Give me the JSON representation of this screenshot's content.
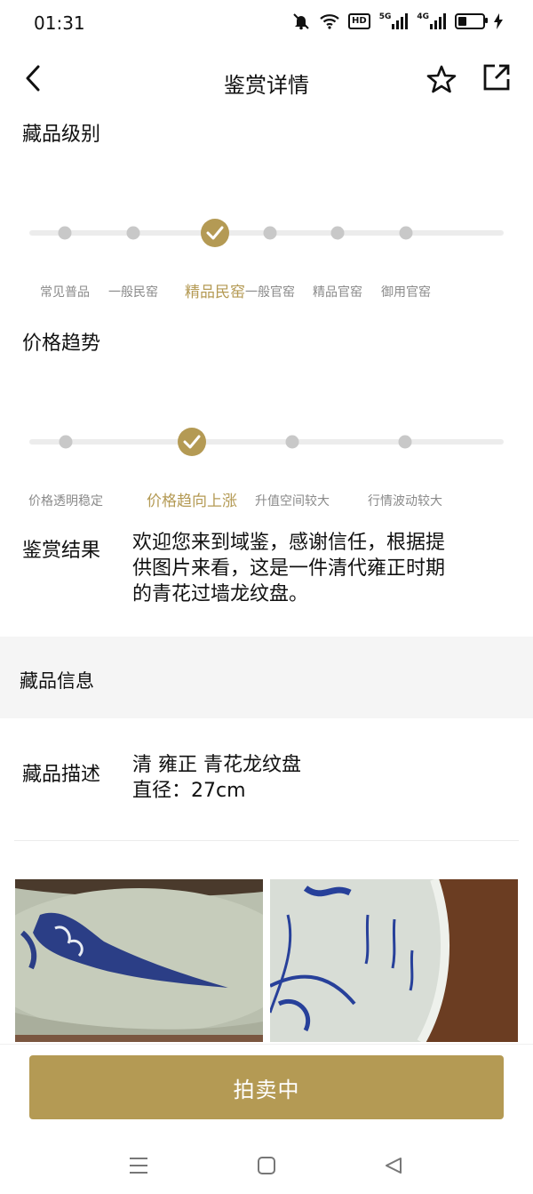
{
  "status_bar": {
    "time": "01:31",
    "hd_label": "HD",
    "net1": "5G",
    "net2": "4G",
    "battery_level": 0.35,
    "icons": [
      "mute-icon",
      "wifi-icon",
      "hd-icon",
      "signal-5g-icon",
      "signal-4g-icon",
      "battery-icon",
      "charging-icon"
    ]
  },
  "header": {
    "title": "鉴赏详情",
    "back_icon": "chevron-left-icon",
    "favorite_icon": "star-outline-icon",
    "share_icon": "share-icon"
  },
  "grade": {
    "title": "藏品级别",
    "levels": [
      "常见普品",
      "一般民窑",
      "精品民窑",
      "一般官窑",
      "精品官窑",
      "御用官窑"
    ],
    "selected_index": 2
  },
  "trend": {
    "title": "价格趋势",
    "levels": [
      "价格透明稳定",
      "价格趋向上涨",
      "升值空间较大",
      "行情波动较大"
    ],
    "selected_index": 1
  },
  "appraisal": {
    "label": "鉴赏结果",
    "lines": [
      "欢迎您来到域鉴，感谢信任，根据提",
      "供图片来看，这是一件清代雍正时期",
      "的青花过墙龙纹盘。"
    ]
  },
  "collection_info": {
    "section_title": "藏品信息",
    "description_label": "藏品描述",
    "description_lines": [
      "清 雍正 青花龙纹盘",
      "直径：27cm"
    ]
  },
  "photos": [
    "porcelain-photo-left",
    "porcelain-photo-right"
  ],
  "cta": {
    "label": "拍卖中"
  },
  "system_nav": [
    "menu-icon",
    "home-icon",
    "back-triangle-icon"
  ],
  "colors": {
    "accent": "#b49a54",
    "muted": "#8a8a8a",
    "track": "#ececec",
    "dot": "#c8c8c8"
  }
}
